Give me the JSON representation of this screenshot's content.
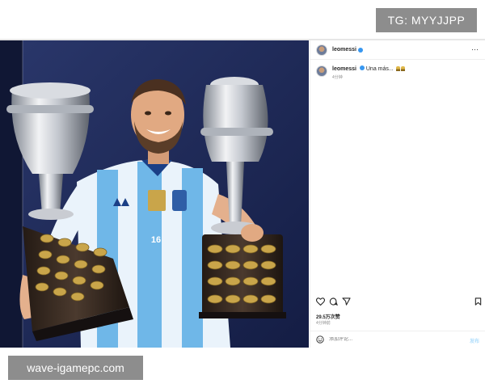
{
  "overlay": {
    "tg_label": "TG: MYYJJPP",
    "site_label": "wave-igamepc.com"
  },
  "post": {
    "username": "leomessi",
    "verified": true,
    "caption": "Una más...",
    "caption_time": "4分钟",
    "likes": "29.5万次赞",
    "time_ago": "4分钟前",
    "comment_placeholder": "添加评论...",
    "post_button": "发布",
    "photo_subject": "player-holding-two-trophies",
    "jersey_number": "16"
  },
  "colors": {
    "verified_blue": "#3897f0",
    "backdrop": "#1d2a5c",
    "jersey_blue": "#6fb7e8",
    "trophy_silver": "#c9ccd2",
    "trophy_base": "#3a2b22",
    "overlay_gray": "#8d8d8d"
  },
  "icons": {
    "header_more": "more-horizontal-icon",
    "like": "heart-icon",
    "comment": "comment-icon",
    "share": "send-icon",
    "save": "bookmark-icon",
    "emoji": "emoji-icon"
  }
}
